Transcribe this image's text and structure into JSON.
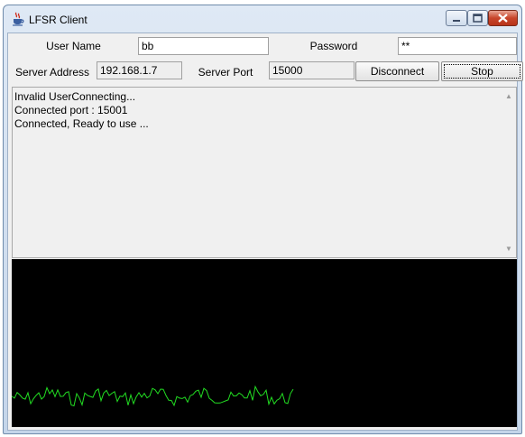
{
  "window": {
    "title": "LFSR Client",
    "icons": {
      "app": "java-coffee-icon",
      "minimize": "minimize-icon",
      "maximize": "maximize-icon",
      "close": "close-icon"
    }
  },
  "form": {
    "username_label": "User Name",
    "username_value": "bb",
    "password_label": "Password",
    "password_value": "**",
    "server_address_label": "Server Address",
    "server_address_value": "192.168.1.7",
    "server_port_label": "Server Port",
    "server_port_value": "15000",
    "disconnect_label": "Disconnect",
    "stop_label": "Stop"
  },
  "log": {
    "lines": [
      "Invalid UserConnecting...",
      "Connected port : 15001",
      "Connected, Ready to use ..."
    ]
  },
  "scope": {
    "background": "#000000",
    "trace_color": "#22dd22"
  }
}
